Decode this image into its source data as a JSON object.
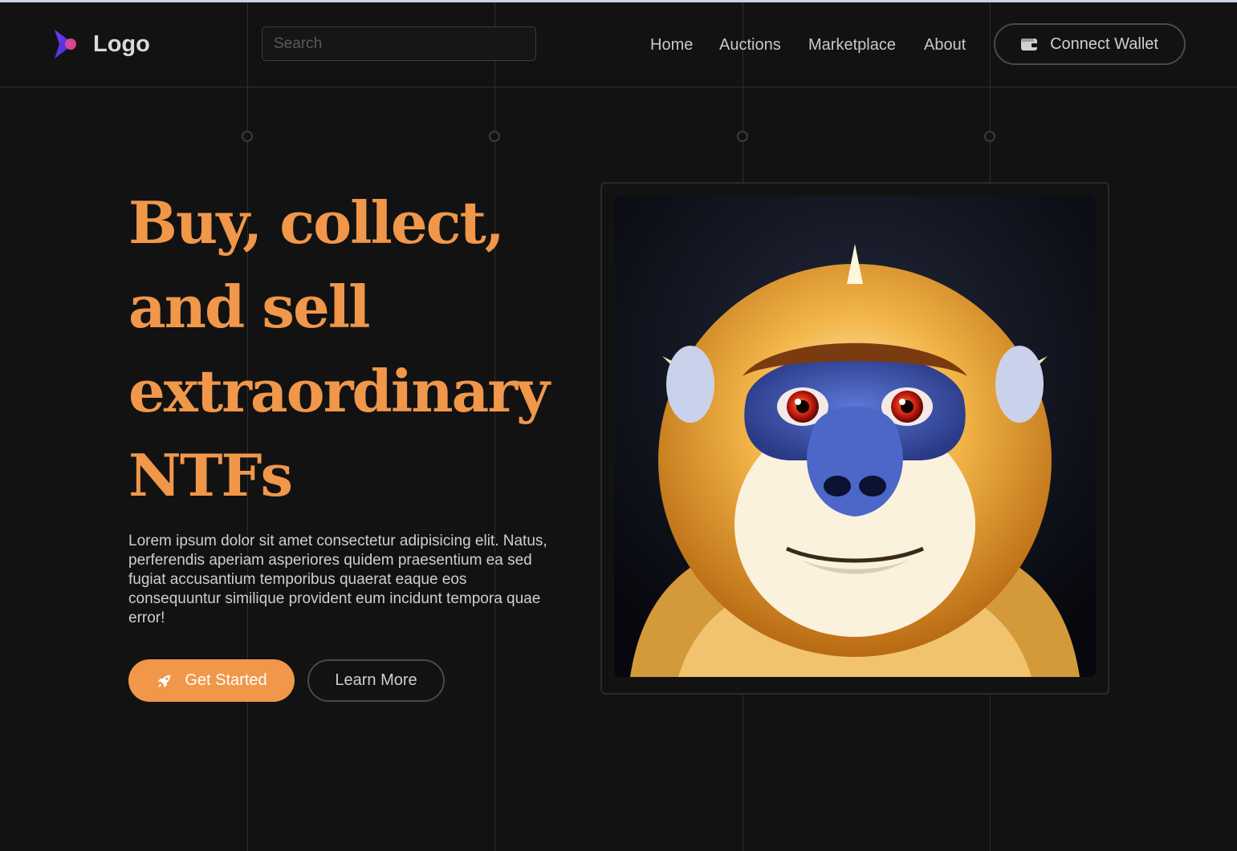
{
  "header": {
    "logo_text": "Logo",
    "search_placeholder": "Search",
    "nav": {
      "home": "Home",
      "auctions": "Auctions",
      "marketplace": "Marketplace",
      "about": "About"
    },
    "connect_wallet_label": "Connect Wallet"
  },
  "hero": {
    "headline": "Buy, collect, and sell extraordinary NTFs",
    "description": "Lorem ipsum dolor sit amet consectetur adipisicing elit. Natus, perferendis aperiam asperiores quidem praesentium ea sed fugiat accusantium temporibus quaerat eaque eos consequuntur similique provident eum incidunt tempora quae error!",
    "primary_button": "Get Started",
    "secondary_button": "Learn More"
  },
  "colors": {
    "background": "#121212",
    "accent": "#f0974a",
    "logo_gradient_start": "#7c3aed",
    "logo_gradient_end": "#ec4899"
  },
  "icons": {
    "logo": "chevron-logo-icon",
    "wallet": "wallet-icon",
    "rocket": "rocket-icon"
  }
}
